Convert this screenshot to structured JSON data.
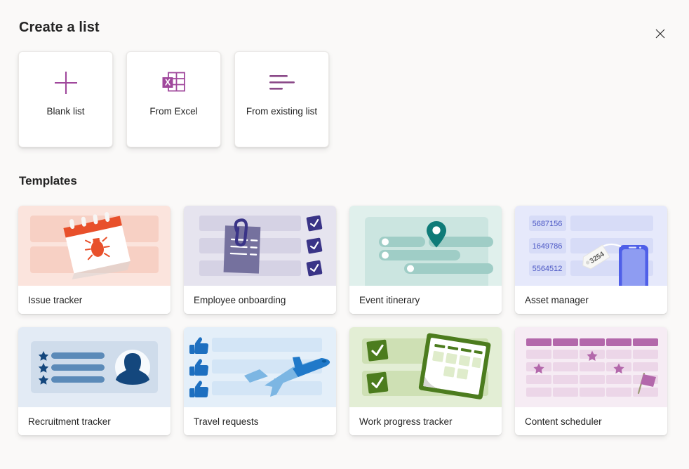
{
  "header": {
    "title": "Create a list",
    "close_label": "Close",
    "close_icon": "close-icon"
  },
  "create_options": [
    {
      "id": "blank-list",
      "label": "Blank list",
      "icon": "plus-icon",
      "accent": "#8b4a89"
    },
    {
      "id": "from-excel",
      "label": "From Excel",
      "icon": "excel-grid-icon",
      "accent": "#a04c9c"
    },
    {
      "id": "from-existing-list",
      "label": "From existing list",
      "icon": "list-lines-icon",
      "accent": "#8b4a89"
    }
  ],
  "templates_section": {
    "title": "Templates"
  },
  "templates": [
    {
      "id": "issue-tracker",
      "label": "Issue tracker",
      "art": "calendar-bug",
      "bg": "#fbe4dd"
    },
    {
      "id": "employee-onboarding",
      "label": "Employee onboarding",
      "art": "clipboard-checks",
      "bg": "#e6e4ef"
    },
    {
      "id": "event-itinerary",
      "label": "Event itinerary",
      "art": "gantt-pin",
      "bg": "#e0f0ec"
    },
    {
      "id": "asset-manager",
      "label": "Asset manager",
      "art": "asset-rows",
      "bg": "#e6e9fb",
      "values": [
        "5687156",
        "1649786",
        "5564512"
      ],
      "tag_value": "3254"
    },
    {
      "id": "recruitment-tracker",
      "label": "Recruitment tracker",
      "art": "profile-stars",
      "bg": "#e3ebf5"
    },
    {
      "id": "travel-requests",
      "label": "Travel requests",
      "art": "plane-thumbs",
      "bg": "#e4eff9"
    },
    {
      "id": "work-progress-tracker",
      "label": "Work progress tracker",
      "art": "green-calendar",
      "bg": "#e3eed5"
    },
    {
      "id": "content-scheduler",
      "label": "Content scheduler",
      "art": "purple-calendar",
      "bg": "#f6ecf4"
    }
  ],
  "colors": {
    "page_background": "#faf9f8",
    "card_background": "#ffffff",
    "text_primary": "#242424",
    "purple_accent": "#8b4a89"
  }
}
